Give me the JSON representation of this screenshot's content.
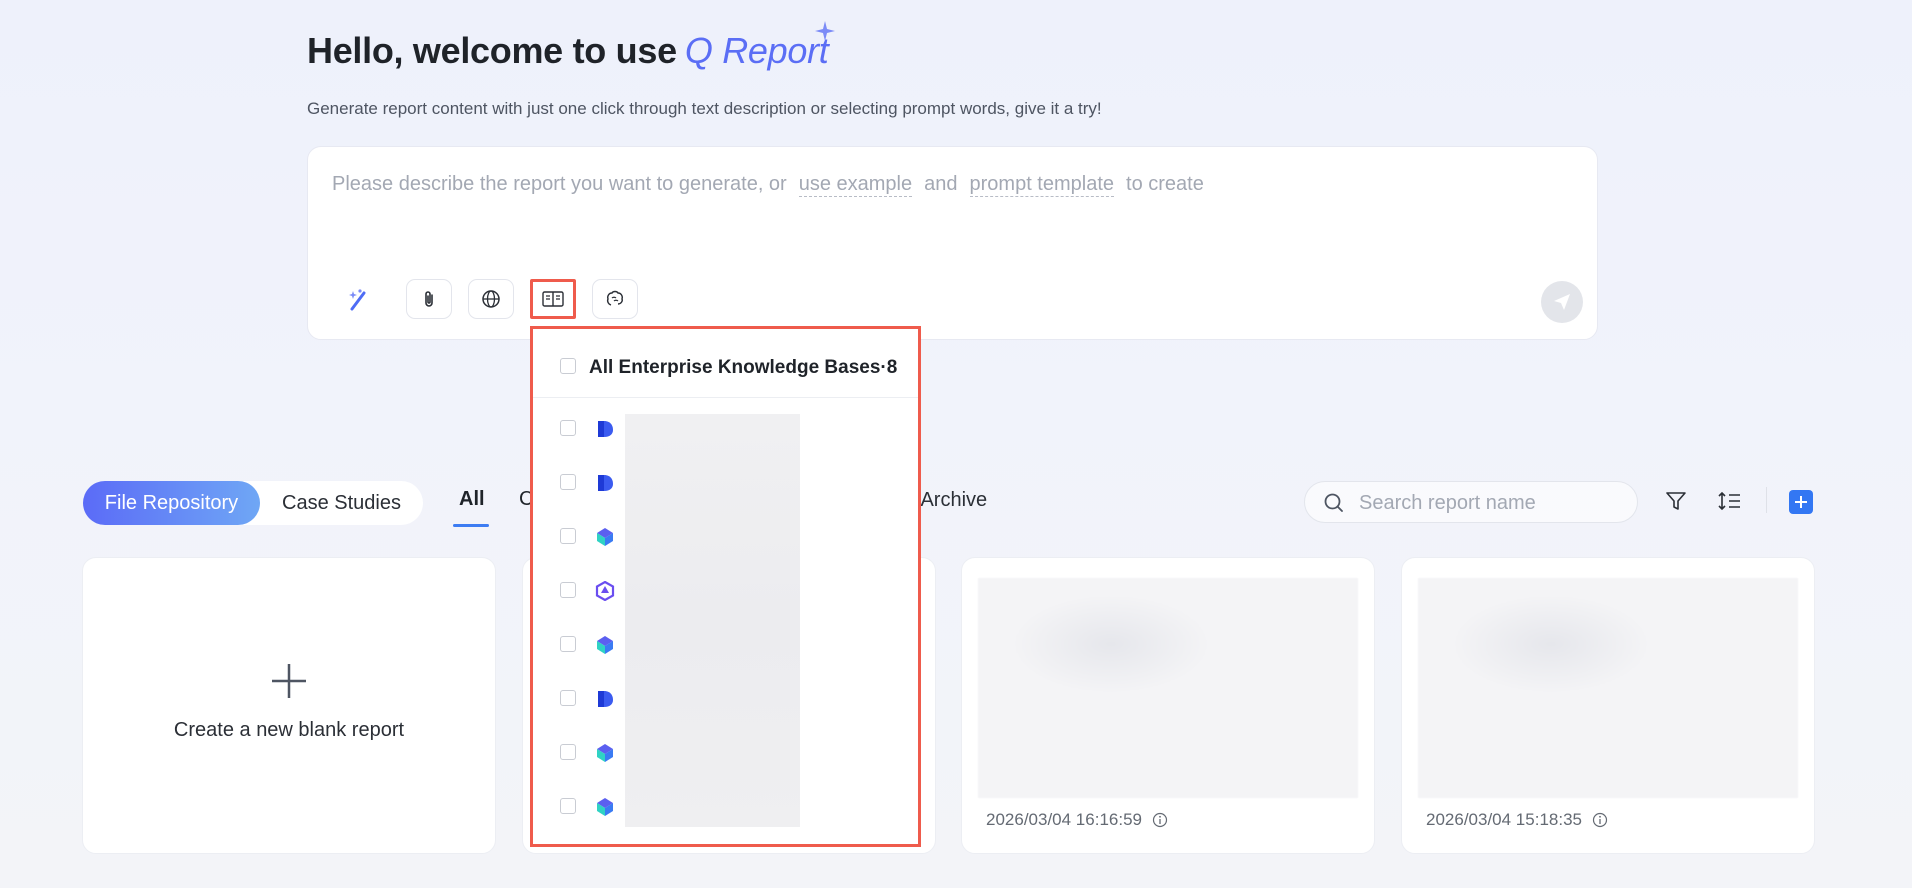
{
  "header": {
    "title_prefix": "Hello, welcome to use",
    "brand": "Q Report",
    "subtitle": "Generate report content with just one click through text description or selecting prompt words, give it a try!"
  },
  "prompt": {
    "placeholder_start": "Please describe the report you want to generate, or",
    "link_example": "use example",
    "and_text": "and",
    "link_template": "prompt template",
    "end_text": "to create"
  },
  "toolbar": {
    "icons": [
      "magic-wand-icon",
      "paperclip-icon",
      "globe-icon",
      "knowledge-base-icon",
      "brain-icon",
      "send-icon"
    ]
  },
  "knowledge_dropdown": {
    "title": "All Enterprise Knowledge Bases",
    "count": "·8",
    "items": [
      {
        "icon": "kb-d-logo-icon"
      },
      {
        "icon": "kb-d-logo-icon"
      },
      {
        "icon": "kb-cube-logo-icon"
      },
      {
        "icon": "kb-hex-logo-icon"
      },
      {
        "icon": "kb-cube-logo-icon"
      },
      {
        "icon": "kb-d-logo-icon"
      },
      {
        "icon": "kb-cube-logo-icon"
      },
      {
        "icon": "kb-cube-logo-icon"
      }
    ]
  },
  "tabs": {
    "segment_active": "File Repository",
    "segment_other": "Case Studies",
    "tab_all": "All",
    "tab_c": "C",
    "tab_archive": "y Archive"
  },
  "search": {
    "placeholder": "Search report name"
  },
  "cards": {
    "blank_label": "Create a new blank report",
    "card3_date": "2026/03/04 16:16:59",
    "card4_date": "2026/03/04 15:18:35"
  },
  "colors": {
    "accent": "#5b6ef5",
    "highlight": "#ef5b4c",
    "primary": "#3377f3"
  }
}
